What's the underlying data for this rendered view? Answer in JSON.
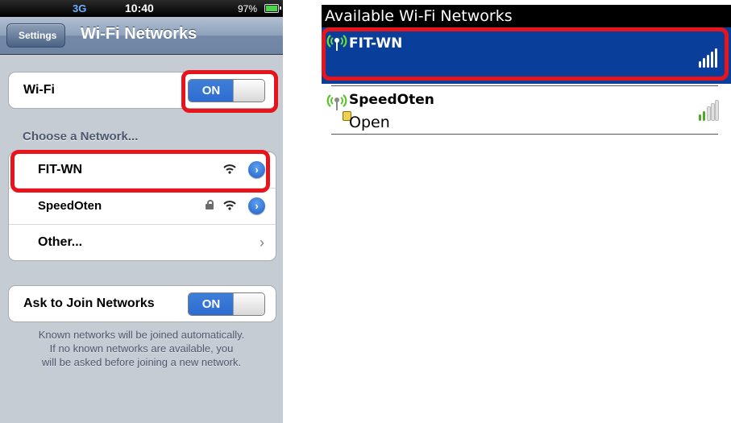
{
  "status_bar": {
    "network": "3G",
    "time": "10:40",
    "battery": "97%"
  },
  "nav": {
    "back_label": "Settings",
    "title": "Wi-Fi Networks"
  },
  "wifi_row": {
    "label": "Wi-Fi",
    "toggle": "ON"
  },
  "section_header": "Choose a Network...",
  "networks": [
    {
      "name": "FIT-WN",
      "locked": false
    },
    {
      "name": "SpeedOten",
      "locked": true
    },
    {
      "name": "Other...",
      "locked": false
    }
  ],
  "ask_row": {
    "label": "Ask to Join Networks",
    "toggle": "ON"
  },
  "footnote": {
    "line1": "Known networks will be joined automatically.",
    "line2": "If no known networks are available, you",
    "line3": "will be asked before joining a new network."
  },
  "bb": {
    "title": "Available Wi-Fi Networks",
    "items": [
      {
        "name": "FIT-WN",
        "security": ""
      },
      {
        "name": "SpeedOten",
        "security": "Open"
      }
    ]
  },
  "colors": {
    "highlight": "#e8141c",
    "ios_blue": "#2e6cd1",
    "bb_selected": "#0a3e9b",
    "signal_green": "#4fa82a"
  },
  "icons": [
    "wifi-icon",
    "lock-icon",
    "detail-disclosure-icon",
    "chevron-right-icon",
    "antenna-icon",
    "signal-bars-icon"
  ]
}
